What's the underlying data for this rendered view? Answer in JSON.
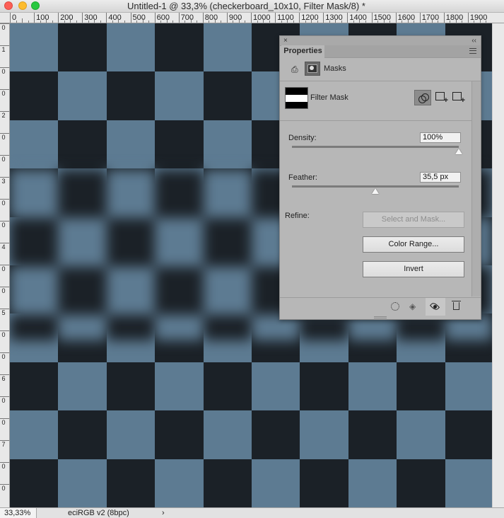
{
  "window": {
    "title": "Untitled-1 @ 33,3% (checkerboard_10x10, Filter Mask/8) *"
  },
  "ruler": {
    "labels": [
      "0",
      "100",
      "200",
      "300",
      "400",
      "500",
      "600",
      "700",
      "800",
      "900",
      "1000",
      "1100",
      "1200",
      "1300",
      "1400",
      "1500",
      "1600",
      "1700",
      "1800",
      "1900"
    ],
    "left_labels": [
      "0",
      "1",
      "0",
      "0",
      "2",
      "0",
      "0",
      "3",
      "0",
      "0",
      "4",
      "0",
      "0",
      "5",
      "0",
      "0",
      "6",
      "0",
      "0",
      "7",
      "0",
      "0"
    ]
  },
  "canvas": {
    "grid": 10,
    "dark_color": "#1b2127",
    "light_color": "#5d7b92"
  },
  "status": {
    "zoom": "33,33%",
    "color_profile": "eciRGB v2 (8bpc)",
    "arrow": "›"
  },
  "panel": {
    "tab": "Properties",
    "close_glyph": "×",
    "collapse_glyph": "‹‹",
    "section": "Masks",
    "mask_name": "Filter Mask",
    "density_label": "Density:",
    "density_value": "100%",
    "density_level": 1.0,
    "feather_label": "Feather:",
    "feather_value": "35,5 px",
    "feather_level": 0.5,
    "refine_label": "Refine:",
    "buttons": {
      "select_and_mask": "Select and Mask...",
      "color_range": "Color Range...",
      "invert": "Invert"
    },
    "icons": {
      "pixel": "lock-mask-icon",
      "vector": "vector-mask-icon",
      "apply": "apply-mask-icon",
      "eye": "eye-icon",
      "trash": "trash-icon"
    }
  }
}
